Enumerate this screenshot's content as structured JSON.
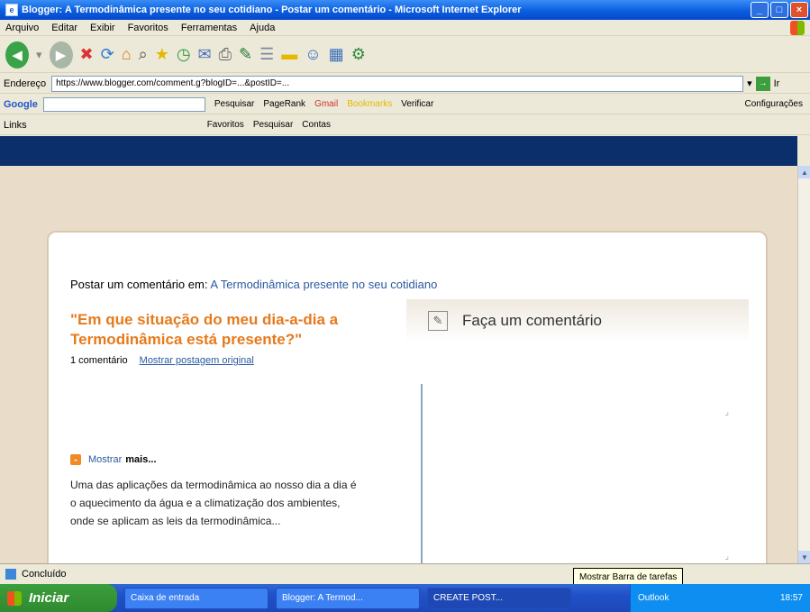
{
  "window": {
    "title": "Blogger: A Termodinâmica presente no seu cotidiano - Postar um comentário - Microsoft Internet Explorer"
  },
  "menu": [
    "Arquivo",
    "Editar",
    "Exibir",
    "Favoritos",
    "Ferramentas",
    "Ajuda"
  ],
  "toolbar": {
    "icons": [
      "back-icon",
      "forward-icon",
      "stop-icon",
      "refresh-icon",
      "home-icon",
      "search-icon",
      "favorites-icon",
      "history-icon",
      "mail-icon",
      "print-icon",
      "edit-icon",
      "discuss-icon",
      "folder-icon",
      "messenger-icon",
      "research-icon",
      "tools-icon"
    ]
  },
  "address": {
    "label": "Endereço",
    "value": "https://www.blogger.com/comment.g?blogID=...&postID=...",
    "go": "Ir"
  },
  "google_bar": {
    "label": "Google",
    "items": [
      "Pesquisar",
      "PageRank",
      "Gmail",
      "Bookmarks",
      "Verificar",
      "Configurações"
    ]
  },
  "links_bar": {
    "label": "Links",
    "items": [
      "Favoritos",
      "Pesquisar",
      "Contas"
    ]
  },
  "post": {
    "prefix": "Postar um comentário em:",
    "link": "A Termodinâmica presente no seu cotidiano",
    "title": "\"Em que situação do meu dia-a-dia a Termodinâmica está presente?\"",
    "meta_count": "1 comentário",
    "meta_link": "Mostrar postagem original"
  },
  "sidebar": {
    "rss_icon": "rss-icon",
    "rss_link": "Mostrar",
    "rss_more": "mais...",
    "excerpt": "Uma das aplicações da termodinâmica ao nosso dia a dia é o aquecimento da água e a climatização dos ambientes, onde se aplicam as leis da termodinâmica..."
  },
  "comment": {
    "heading": "Faça um comentário"
  },
  "status": {
    "text": "Concluído",
    "tooltip": "Mostrar Barra de tarefas"
  },
  "taskbar": {
    "start": "Iniciar",
    "tasks": [
      "Caixa de entrada",
      "Blogger: A Termod...",
      "CREATE POST..."
    ],
    "tray": "Outlook",
    "clock": "18:57"
  }
}
